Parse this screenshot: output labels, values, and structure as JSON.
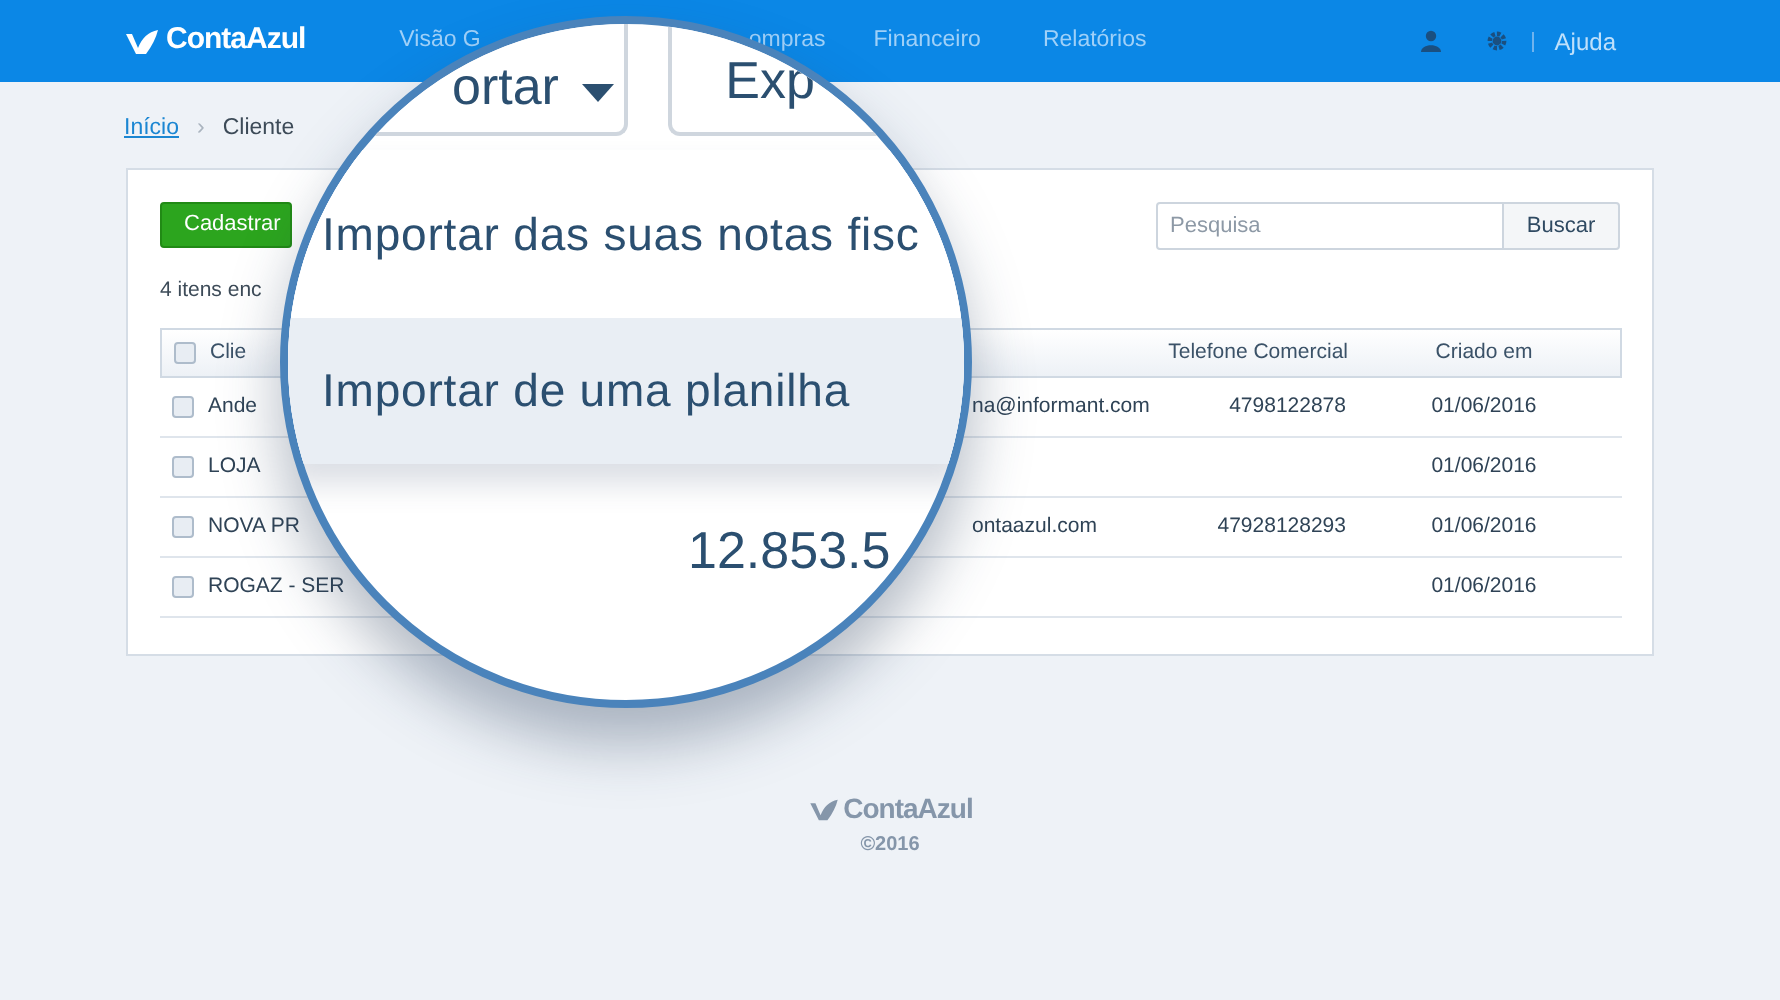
{
  "header": {
    "logo": "ContaAzul",
    "nav": [
      "Visão G",
      "ompras",
      "Financeiro",
      "Relatórios"
    ],
    "help": "Ajuda"
  },
  "breadcrumb": {
    "link": "Início",
    "separator": "›",
    "current": "Cliente"
  },
  "toolbar": {
    "add_button": "Cadastrar",
    "search": {
      "placeholder": "Pesquisa"
    },
    "search_button": "Buscar"
  },
  "count": "4 itens enc",
  "table": {
    "header_checked": false,
    "columns": [
      "Clie",
      "Telefone Comercial",
      "Criado em"
    ],
    "rows": [
      {
        "checked": false,
        "name": "Ande",
        "email": "na@informant.com",
        "phone": "4798122878",
        "created": "01/06/2016"
      },
      {
        "checked": false,
        "name": "LOJA",
        "created": "01/06/2016"
      },
      {
        "checked": false,
        "name": "NOVA PR",
        "email": "ontaazul.com",
        "phone": "47928128293",
        "created": "01/06/2016"
      },
      {
        "checked": false,
        "name": "ROGAZ - SER",
        "created": "01/06/2016"
      }
    ]
  },
  "magnifier": {
    "tabs": [
      "ortar",
      "Exp"
    ],
    "menu": [
      {
        "label": "Importar das suas notas fisc",
        "selected": false
      },
      {
        "label": "Importar de uma planilha",
        "selected": true
      }
    ],
    "amount": "12.853.5"
  },
  "footer": {
    "logo": "ContaAzul",
    "copyright": "©2016"
  }
}
